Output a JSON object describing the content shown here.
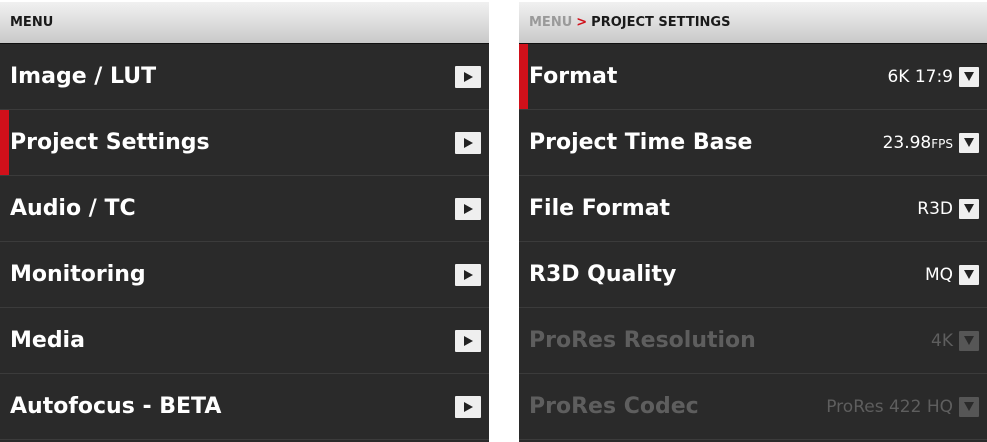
{
  "left": {
    "header": "MENU",
    "items": [
      {
        "label": "Image / LUT"
      },
      {
        "label": "Project Settings"
      },
      {
        "label": "Audio / TC"
      },
      {
        "label": "Monitoring"
      },
      {
        "label": "Media"
      },
      {
        "label": "Autofocus - BETA"
      }
    ]
  },
  "right": {
    "breadcrumb": {
      "root": "MENU",
      "separator": ">",
      "current": "PROJECT SETTINGS"
    },
    "settings": [
      {
        "label": "Format",
        "value": "6K 17:9"
      },
      {
        "label": "Project Time Base",
        "value": "23.98",
        "unit": "FPS"
      },
      {
        "label": "File Format",
        "value": "R3D"
      },
      {
        "label": "R3D Quality",
        "value": "MQ"
      },
      {
        "label": "ProRes Resolution",
        "value": "4K"
      },
      {
        "label": "ProRes Codec",
        "value": "ProRes 422 HQ"
      }
    ]
  },
  "icons": {
    "submenu_arrow": "chevron-right-icon",
    "dropdown_arrow": "chevron-down-icon"
  },
  "colors": {
    "accent": "#d0101a",
    "panel_bg": "#2a2a2a",
    "header_bg": "#dcdcdc",
    "disabled_text": "#5e5e5e"
  }
}
